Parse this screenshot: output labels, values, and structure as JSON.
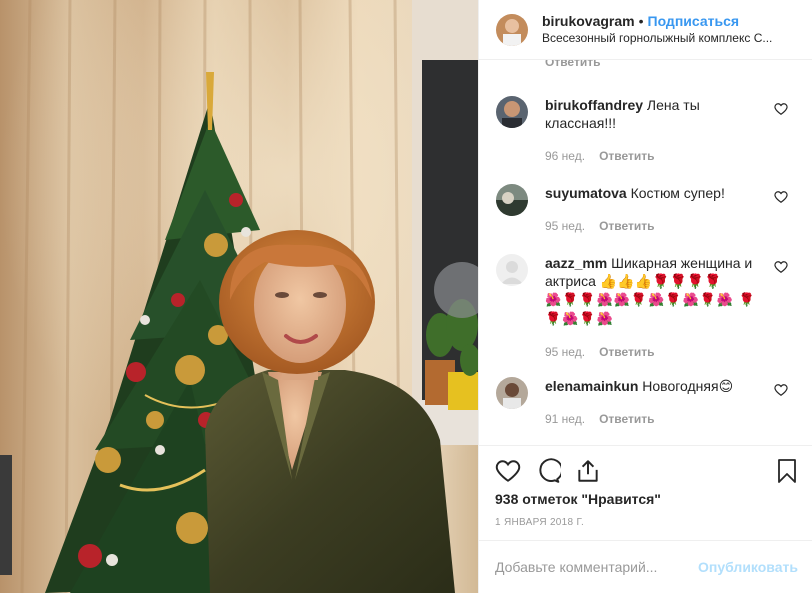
{
  "post": {
    "username": "birukovagram",
    "separator": "•",
    "follow_label": "Подписаться",
    "location": "Всесезонный горнолыжный комплекс С..."
  },
  "comments_partial_reply": "Ответить",
  "comments": [
    {
      "user": "birukoffandrey",
      "text": "Лена ты классная!!!",
      "emoji": "",
      "age": "96 нед.",
      "reply": "Ответить"
    },
    {
      "user": "suyumatova",
      "text": "Костюм супер!",
      "emoji": "",
      "age": "95 нед.",
      "reply": "Ответить"
    },
    {
      "user": "aazz_mm",
      "text": "Шикарная женщина и актриса 👍👍👍🌹🌹🌹🌹",
      "emoji": "🌺🌹🌹🌺🌺🌹🌺🌹🌺🌹🌺 🌹🌹🌺🌹🌺",
      "age": "95 нед.",
      "reply": "Ответить"
    },
    {
      "user": "elenamainkun",
      "text": "Новогодняя😊",
      "emoji": "",
      "age": "91 нед.",
      "reply": "Ответить"
    }
  ],
  "actions": {
    "likes": "938 отметок \"Нравится\"",
    "date": "1 ЯНВАРЯ 2018 Г."
  },
  "add_comment": {
    "placeholder": "Добавьте комментарий...",
    "publish_label": "Опубликовать"
  },
  "icons": [
    "heart-icon",
    "comment-icon",
    "share-icon",
    "bookmark-icon"
  ],
  "colors": {
    "accent": "#3897f0",
    "muted": "#999999",
    "publish_disabled": "#b2dffc"
  }
}
